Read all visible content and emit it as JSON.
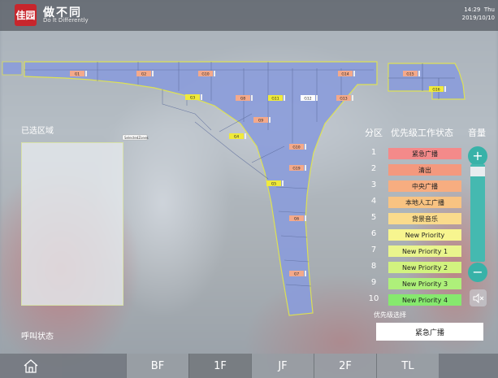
{
  "header": {
    "logo_seal": "佳园",
    "logo_title": "做不同",
    "logo_subtitle": "Do It Differently",
    "time": "14:29",
    "weekday": "Thu",
    "date": "2019/10/10"
  },
  "map": {
    "zones": [
      {
        "id": "G1",
        "color": "#f4a98a"
      },
      {
        "id": "G2",
        "color": "#f4a98a"
      },
      {
        "id": "G10",
        "color": "#f4a98a"
      },
      {
        "id": "G3",
        "color": "#f0ea3a"
      },
      {
        "id": "G8",
        "color": "#f4a98a"
      },
      {
        "id": "G11",
        "color": "#f0ea3a"
      },
      {
        "id": "G12",
        "color": "#ffffff"
      },
      {
        "id": "G13",
        "color": "#f4a98a"
      },
      {
        "id": "G14",
        "color": "#f4a98a"
      },
      {
        "id": "G15",
        "color": "#f4a98a"
      },
      {
        "id": "G16",
        "color": "#f0ea3a"
      },
      {
        "id": "G9",
        "color": "#f4a98a"
      },
      {
        "id": "G4",
        "color": "#f0ea3a"
      },
      {
        "id": "G10",
        "color": "#f4a98a"
      },
      {
        "id": "G19",
        "color": "#f4a98a"
      },
      {
        "id": "G5",
        "color": "#f0ea3a"
      },
      {
        "id": "G6",
        "color": "#f4a98a"
      },
      {
        "id": "G7",
        "color": "#f4a98a"
      }
    ],
    "tooltip": "SelectedZones"
  },
  "left_panel": {
    "selected_area_label": "已选区域",
    "call_status_label": "呼叫状态"
  },
  "priority_panel": {
    "col_zone": "分区",
    "col_priority": "优先级工作状态",
    "col_volume": "音量",
    "rows": [
      {
        "num": "1",
        "label": "紧急广播",
        "color": "#f48a8a"
      },
      {
        "num": "2",
        "label": "清出",
        "color": "#f4997e"
      },
      {
        "num": "3",
        "label": "中央广播",
        "color": "#f7ad80"
      },
      {
        "num": "4",
        "label": "本地人工广播",
        "color": "#f8c382"
      },
      {
        "num": "5",
        "label": "背景音乐",
        "color": "#fadb8c"
      },
      {
        "num": "6",
        "label": "New Priority",
        "color": "#f7f58f"
      },
      {
        "num": "7",
        "label": "New Priority 1",
        "color": "#e9f58d"
      },
      {
        "num": "8",
        "label": "New Priority 2",
        "color": "#d2f37f"
      },
      {
        "num": "9",
        "label": "New Priority 3",
        "color": "#aef07a"
      },
      {
        "num": "10",
        "label": "New Priority 4",
        "color": "#86e96e"
      }
    ],
    "volume_level": 0.97,
    "vol_plus": "+",
    "vol_minus": "−",
    "priority_select_label": "优先级选择",
    "priority_select_value": "紧急广播"
  },
  "bottom_nav": {
    "floors": [
      "BF",
      "1F",
      "JF",
      "2F",
      "TL"
    ],
    "active_floor": "1F"
  },
  "colors": {
    "accent_teal": "#38b2a8",
    "map_fill": "#8b9ddb",
    "map_outline": "#e2e64a"
  }
}
